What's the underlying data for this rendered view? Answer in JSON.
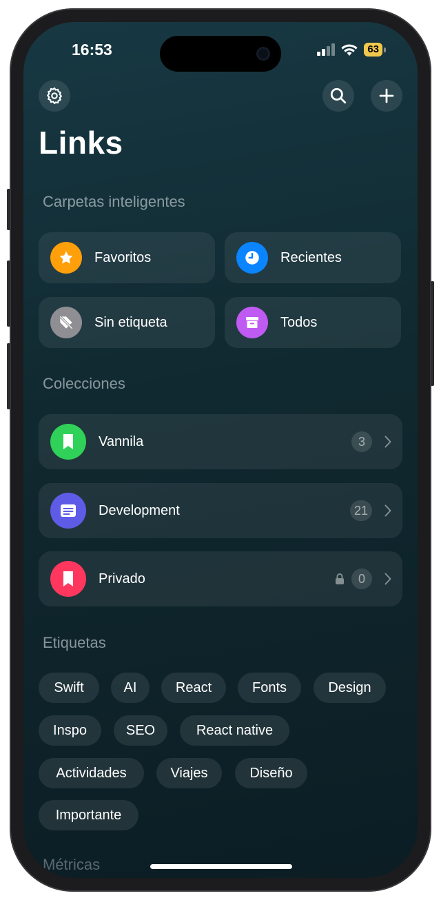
{
  "status_bar": {
    "time": "16:53",
    "battery": "63"
  },
  "header": {
    "title": "Links"
  },
  "sections": {
    "smart": "Carpetas inteligentes",
    "collections": "Colecciones",
    "tags": "Etiquetas",
    "metrics": "Métricas"
  },
  "smart_folders": [
    {
      "label": "Favoritos",
      "icon": "star-icon",
      "color": "#ff9f0a"
    },
    {
      "label": "Recientes",
      "icon": "clock-icon",
      "color": "#0a84ff"
    },
    {
      "label": "Sin etiqueta",
      "icon": "tag-slash-icon",
      "color": "#8e8e93"
    },
    {
      "label": "Todos",
      "icon": "archive-box-icon",
      "color": "#bf5af2"
    }
  ],
  "collections": [
    {
      "label": "Vannila",
      "count": "3",
      "icon": "bookmark-icon",
      "color": "#30d158",
      "locked": false
    },
    {
      "label": "Development",
      "count": "21",
      "icon": "list-card-icon",
      "color": "#5e5ce6",
      "locked": false
    },
    {
      "label": "Privado",
      "count": "0",
      "icon": "bookmark-icon",
      "color": "#ff375f",
      "locked": true
    }
  ],
  "tags": [
    "Swift",
    "AI",
    "React",
    "Fonts",
    "Design",
    "Inspo",
    "SEO",
    "React native",
    "Actividades",
    "Viajes",
    "Diseño",
    "Importante"
  ]
}
